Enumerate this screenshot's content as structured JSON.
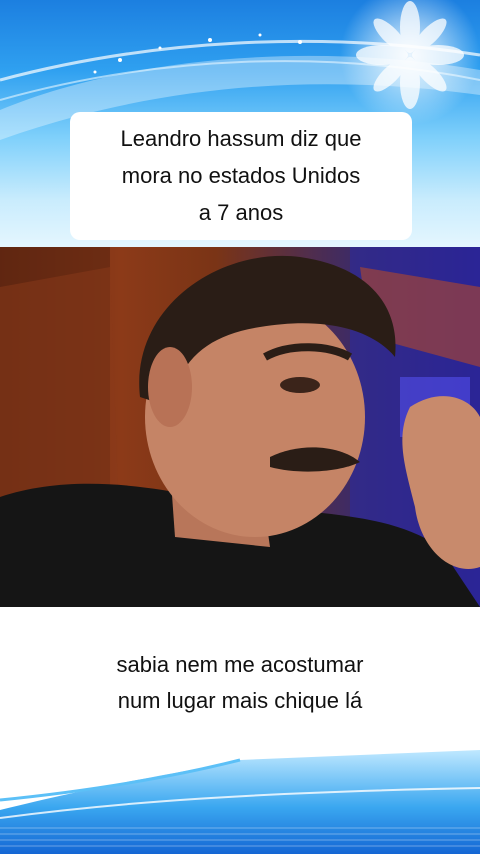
{
  "caption": {
    "lines": [
      "Leandro hassum diz que",
      "mora no estados Unidos",
      "a 7 anos"
    ]
  },
  "subtitle": {
    "lines": [
      "sabia nem me acostumar",
      "num lugar mais chique lá"
    ]
  },
  "colors": {
    "banner_blue": "#1c7fe0",
    "banner_light": "#c9ecfd",
    "text": "#111111"
  }
}
